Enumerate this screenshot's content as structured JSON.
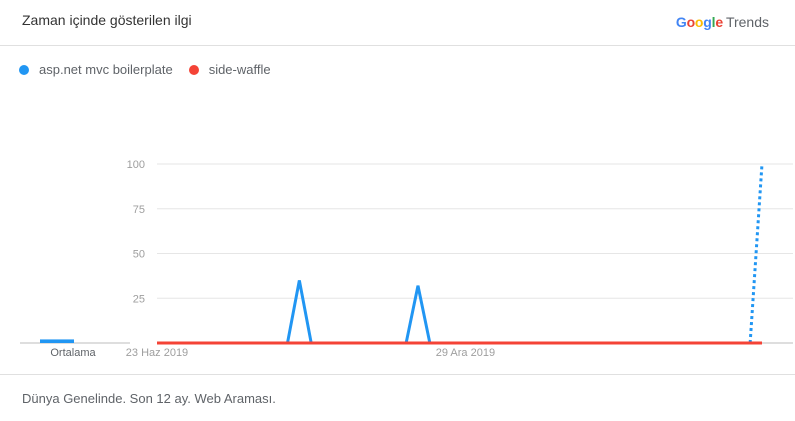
{
  "header": {
    "title": "Zaman içinde gösterilen ilgi",
    "brand_google": [
      "G",
      "o",
      "o",
      "g",
      "l",
      "e"
    ],
    "brand_trends": "Trends"
  },
  "colors": {
    "series1": "#2196f3",
    "series2": "#f44336",
    "brand": [
      "#4285F4",
      "#EA4335",
      "#FBBC05",
      "#4285F4",
      "#34A853",
      "#EA4335"
    ]
  },
  "footer": {
    "text": "Dünya Genelinde. Son 12 ay. Web Araması."
  },
  "chart_data": {
    "type": "line",
    "x_ticks": [
      "23 Haz 2019",
      "29 Ara 2019"
    ],
    "y_ticks": [
      25,
      50,
      75,
      100
    ],
    "ylim": [
      0,
      100
    ],
    "grid": true,
    "legend": "top-left",
    "average_label": "Ortalama",
    "averages": [
      2,
      0
    ],
    "x_range": [
      0,
      51
    ],
    "series": [
      {
        "name": "asp.net mvc boilerplate",
        "color": "#2196f3",
        "values": [
          0,
          0,
          0,
          0,
          0,
          0,
          0,
          0,
          0,
          0,
          0,
          0,
          35,
          0,
          0,
          0,
          0,
          0,
          0,
          0,
          0,
          0,
          32,
          0,
          0,
          0,
          0,
          0,
          0,
          0,
          0,
          0,
          0,
          0,
          0,
          0,
          0,
          0,
          0,
          0,
          0,
          0,
          0,
          0,
          0,
          0,
          0,
          0,
          0,
          0,
          0,
          100
        ],
        "partial_from_index": 50
      },
      {
        "name": "side-waffle",
        "color": "#f44336",
        "values": [
          0,
          0,
          0,
          0,
          0,
          0,
          0,
          0,
          0,
          0,
          0,
          0,
          0,
          0,
          0,
          0,
          0,
          0,
          0,
          0,
          0,
          0,
          0,
          0,
          0,
          0,
          0,
          0,
          0,
          0,
          0,
          0,
          0,
          0,
          0,
          0,
          0,
          0,
          0,
          0,
          0,
          0,
          0,
          0,
          0,
          0,
          0,
          0,
          0,
          0,
          0,
          0
        ]
      }
    ]
  }
}
